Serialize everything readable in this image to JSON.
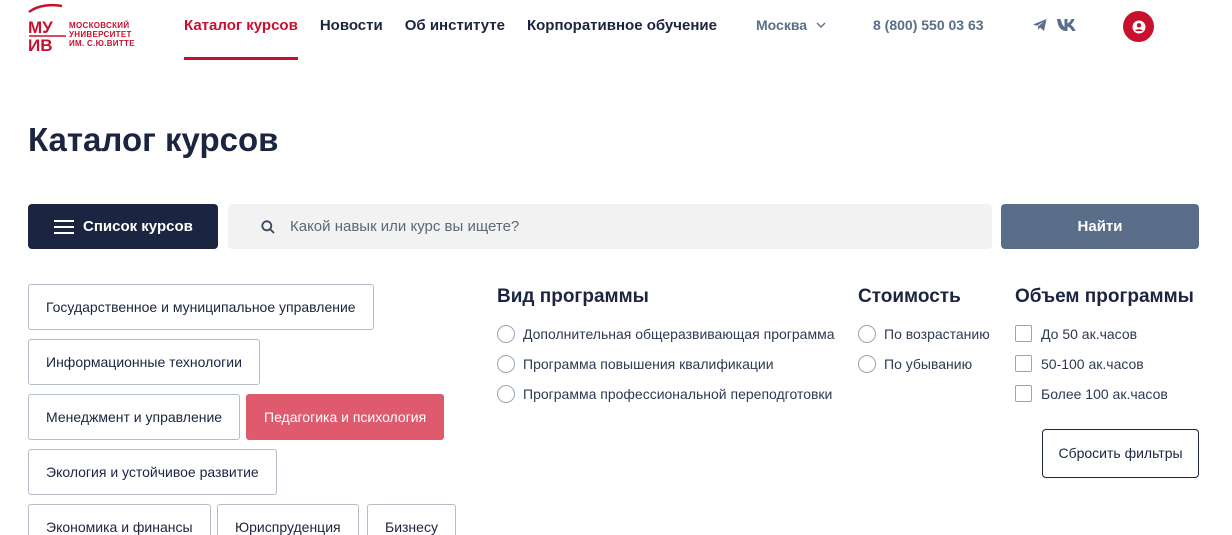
{
  "header": {
    "logo": {
      "mark": "МУ ИВ",
      "lines": [
        "МОСКОВСКИЙ",
        "УНИВЕРСИТЕТ",
        "ИМ. С.Ю.ВИТТЕ"
      ]
    },
    "nav": [
      {
        "label": "Каталог курсов",
        "active": true
      },
      {
        "label": "Новости",
        "active": false
      },
      {
        "label": "Об институте",
        "active": false
      },
      {
        "label": "Корпоративное обучение",
        "active": false
      }
    ],
    "city": "Москва",
    "phone": "8 (800) 550 03 63",
    "social": [
      "telegram-icon",
      "vk-icon"
    ],
    "brand_color": "#c8102e"
  },
  "page": {
    "title": "Каталог курсов"
  },
  "search": {
    "list_button": "Список курсов",
    "placeholder": "Какой навык или курс вы ищете?",
    "value": "",
    "find_button": "Найти"
  },
  "categories": [
    {
      "label": "Государственное и муниципальное управление",
      "active": false
    },
    {
      "label": "Информационные технологии",
      "active": false
    },
    {
      "label": "Менеджмент и управление",
      "active": false
    },
    {
      "label": "Педагогика и психология",
      "active": true
    },
    {
      "label": "Экология и устойчивое развитие",
      "active": false
    },
    {
      "label": "Экономика и финансы",
      "active": false
    },
    {
      "label": "Юриспруденция",
      "active": false
    },
    {
      "label": "Бизнесу",
      "active": false
    }
  ],
  "filters": {
    "program_type": {
      "title": "Вид программы",
      "options": [
        "Дополнительная общеразвивающая программа",
        "Программа повышения квалификации",
        "Программа профессиональной переподготовки"
      ]
    },
    "cost": {
      "title": "Стоимость",
      "options": [
        "По возрастанию",
        "По убыванию"
      ]
    },
    "volume": {
      "title": "Объем программы",
      "options": [
        "До 50 ак.часов",
        "50-100 ак.часов",
        "Более 100 ак.часов"
      ]
    },
    "reset_button": "Сбросить фильтры"
  },
  "colors": {
    "navy": "#1b2440",
    "slate": "#5a6e8a",
    "accent_pink": "#e05a6e",
    "red": "#c8102e"
  }
}
